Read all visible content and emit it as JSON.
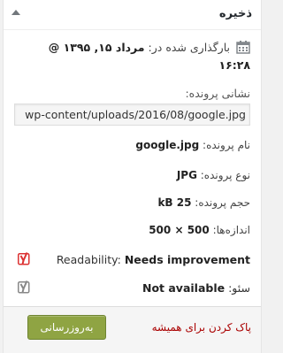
{
  "panel": {
    "title": "ذخیره"
  },
  "published": {
    "label": "بارگذاری شده در:",
    "date": "مرداد ۱۵, ۱۳۹۵ @ ۱۶:۲۸"
  },
  "file_url": {
    "label": "نشانی پرونده:",
    "value": "wp-content/uploads/2016/08/google.jpg"
  },
  "meta": {
    "file_name_label": "نام پرونده:",
    "file_name": "google.jpg",
    "file_type_label": "نوع پرونده:",
    "file_type": "JPG",
    "file_size_label": "حجم پرونده:",
    "file_size": "25 kB",
    "dimensions_label": "اندازه‌ها:",
    "dimensions": "500 × 500"
  },
  "seo": {
    "readability_label": "Readability:",
    "readability_value": "Needs improvement",
    "seo_label": "سئو:",
    "seo_value": "Not available",
    "readability_icon_color": "#dc3232",
    "seo_icon_color": "#888888"
  },
  "actions": {
    "delete_label": "پاک کردن برای همیشه",
    "update_label": "به‌روزرسانی",
    "update_color": "#8fa443",
    "delete_color": "#aa0000"
  }
}
